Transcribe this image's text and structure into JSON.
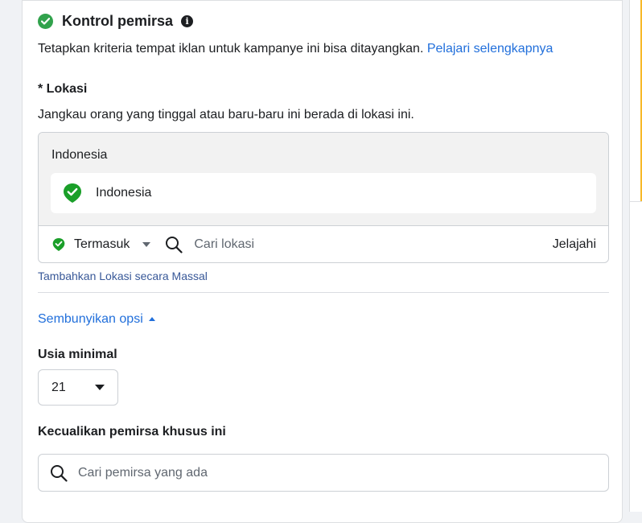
{
  "header": {
    "title": "Kontrol pemirsa",
    "info_icon": "info-icon",
    "status_icon": "check-circle-icon",
    "accent_color": "#31a24c"
  },
  "description": {
    "text": "Tetapkan kriteria tempat iklan untuk kampanye ini bisa ditayangkan.",
    "link": "Pelajari selengkapnya"
  },
  "location": {
    "label": "* Lokasi",
    "sublabel": "Jangkau orang yang tinggal atau baru-baru ini berada di lokasi ini.",
    "country_group": "Indonesia",
    "selected_items": [
      {
        "label": "Indonesia",
        "icon": "location-pin-icon"
      }
    ],
    "include_dropdown": "Termasuk",
    "search_placeholder": "Cari lokasi",
    "browse_label": "Jelajahi",
    "bulk_add_link": "Tambahkan Lokasi secara Massal"
  },
  "options": {
    "toggle_label": "Sembunyikan opsi"
  },
  "min_age": {
    "label": "Usia minimal",
    "value": "21"
  },
  "exclude_audience": {
    "label": "Kecualikan pemirsa khusus ini",
    "search_placeholder": "Cari pemirsa yang ada"
  },
  "colors": {
    "link": "#216fdb",
    "success": "#31a24c",
    "bulk_link": "#385898",
    "warning_accent": "#f7b928"
  }
}
